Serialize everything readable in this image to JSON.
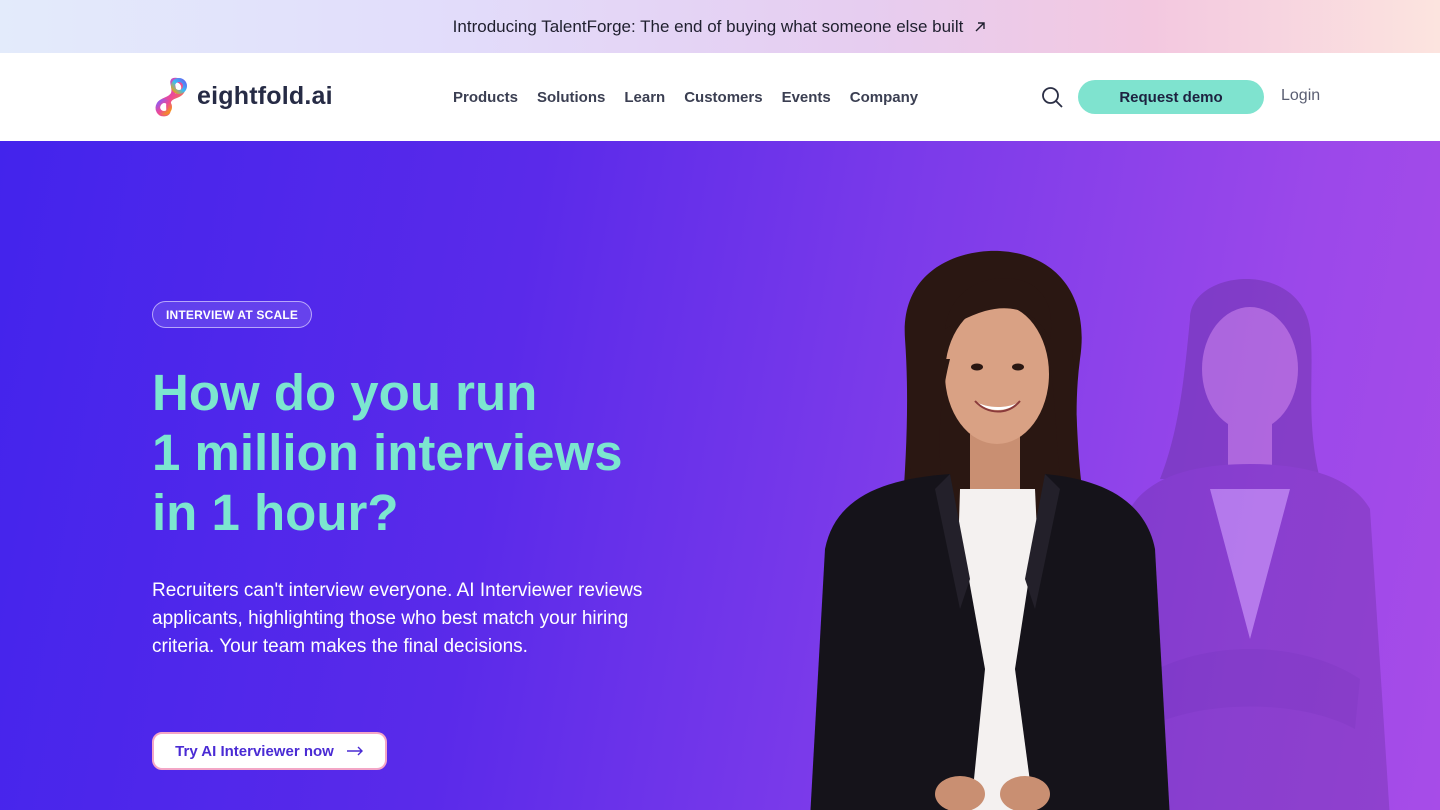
{
  "announcement": {
    "text": "Introducing TalentForge: The end of buying what someone else built",
    "icon": "arrow-up-right-icon"
  },
  "header": {
    "logo_text": "eightfold.ai",
    "nav": [
      "Products",
      "Solutions",
      "Learn",
      "Customers",
      "Events",
      "Company"
    ],
    "search_icon": "search-icon",
    "demo_label": "Request demo",
    "login_label": "Login"
  },
  "hero": {
    "badge": "INTERVIEW AT SCALE",
    "headline": [
      "How do you run",
      "1 million interviews",
      "in 1 hour?"
    ],
    "subtext": "Recruiters can't interview everyone. AI Interviewer reviews applicants, highlighting those who best match your hiring criteria. Your team makes the final decisions.",
    "cta_label": "Try AI Interviewer now",
    "cta_icon": "arrow-right-icon"
  },
  "colors": {
    "accent_mint": "#7ce6cf",
    "hero_start": "#4324ec",
    "hero_end": "#a74ce8",
    "cta_text": "#4a2bd4"
  }
}
